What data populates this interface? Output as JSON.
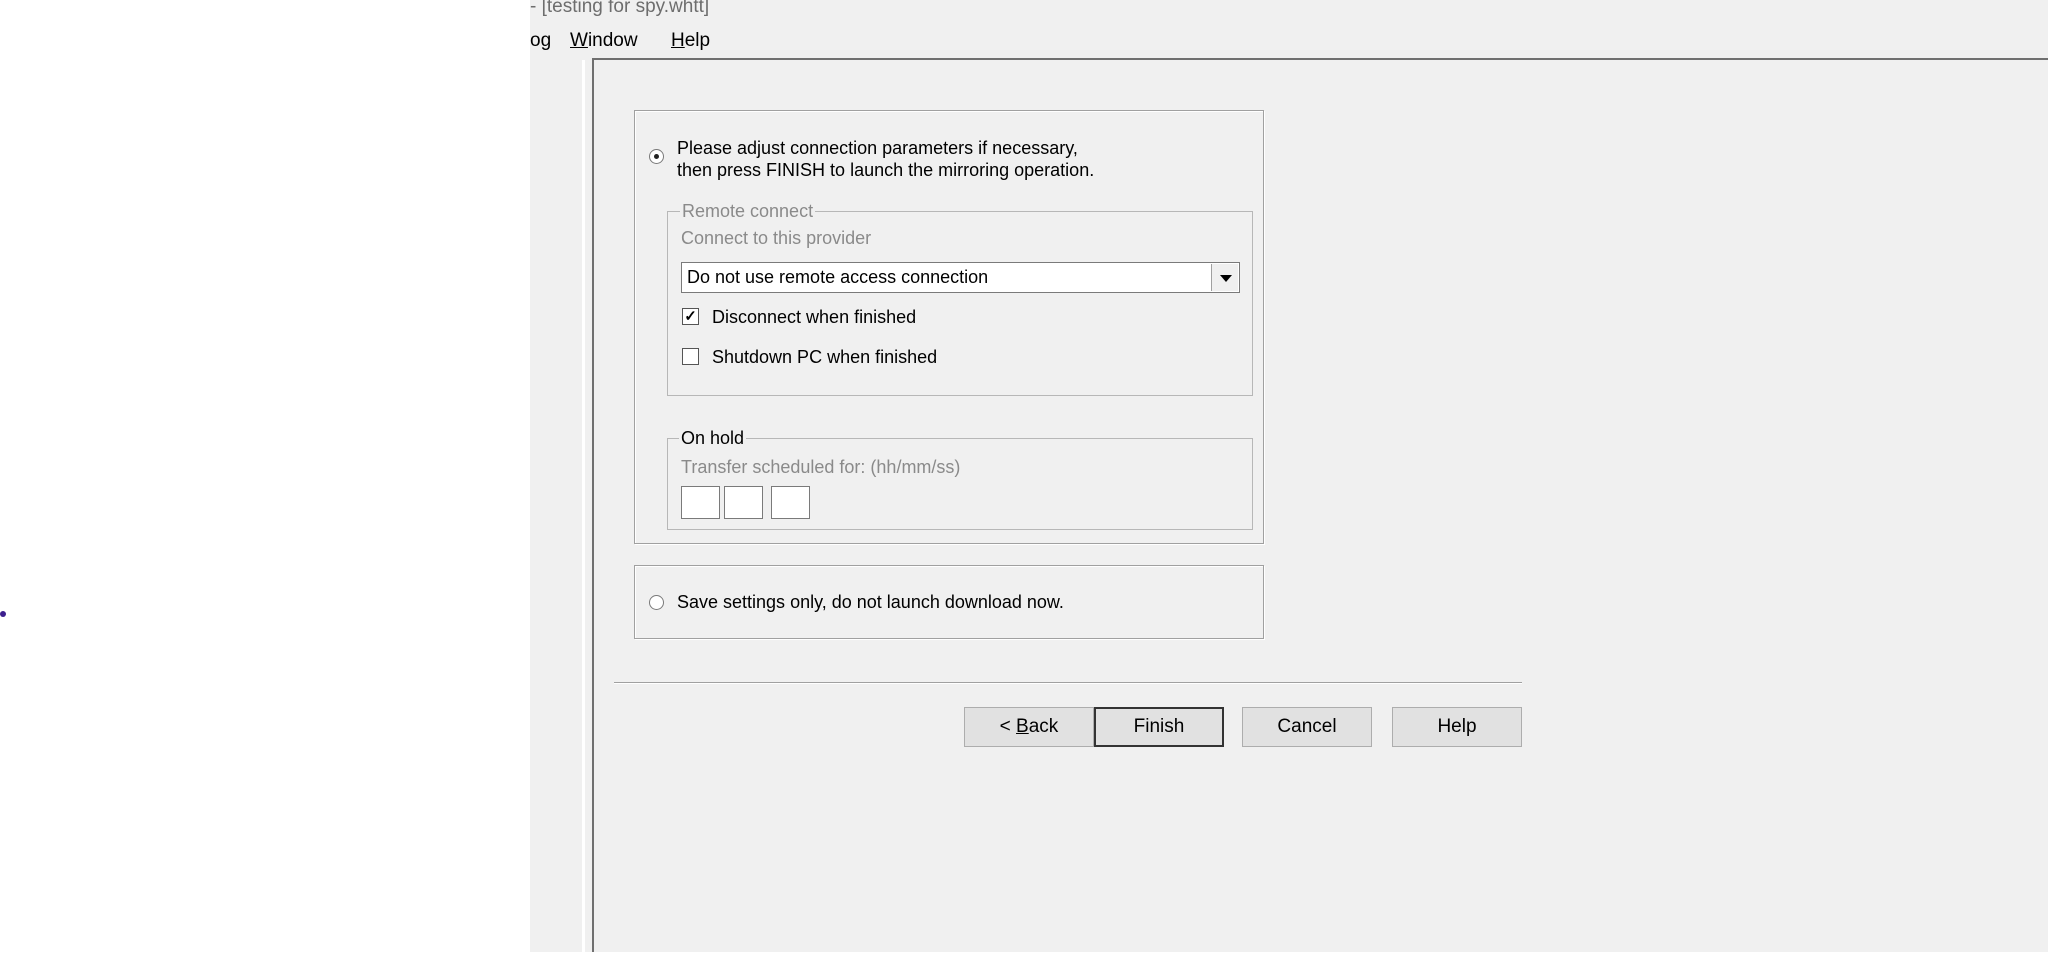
{
  "window": {
    "title": "- [testing for spy.whtt]"
  },
  "menu": {
    "items": [
      {
        "label": "og",
        "underline": ""
      },
      {
        "label": "indow",
        "underline": "W"
      },
      {
        "label": "elp",
        "underline": "H"
      }
    ]
  },
  "wizard": {
    "option_launch": {
      "line1": "Please adjust connection parameters if necessary,",
      "line2": "then press FINISH to launch the mirroring operation.",
      "selected": true
    },
    "remote_connect": {
      "legend": "Remote connect",
      "provider_label": "Connect to this provider",
      "provider_value": "Do not use remote access connection",
      "disconnect_label": "Disconnect when finished",
      "disconnect_checked": true,
      "shutdown_label": "Shutdown PC when finished",
      "shutdown_checked": false
    },
    "on_hold": {
      "legend": "On hold",
      "schedule_label": "Transfer scheduled for: (hh/mm/ss)",
      "hh": "",
      "mm": "",
      "ss": ""
    },
    "option_save": {
      "label": "Save settings only, do not launch download now.",
      "selected": false
    }
  },
  "buttons": {
    "back_prefix": "< ",
    "back_underline": "B",
    "back_rest": "ack",
    "finish": "Finish",
    "cancel": "Cancel",
    "help": "Help"
  }
}
